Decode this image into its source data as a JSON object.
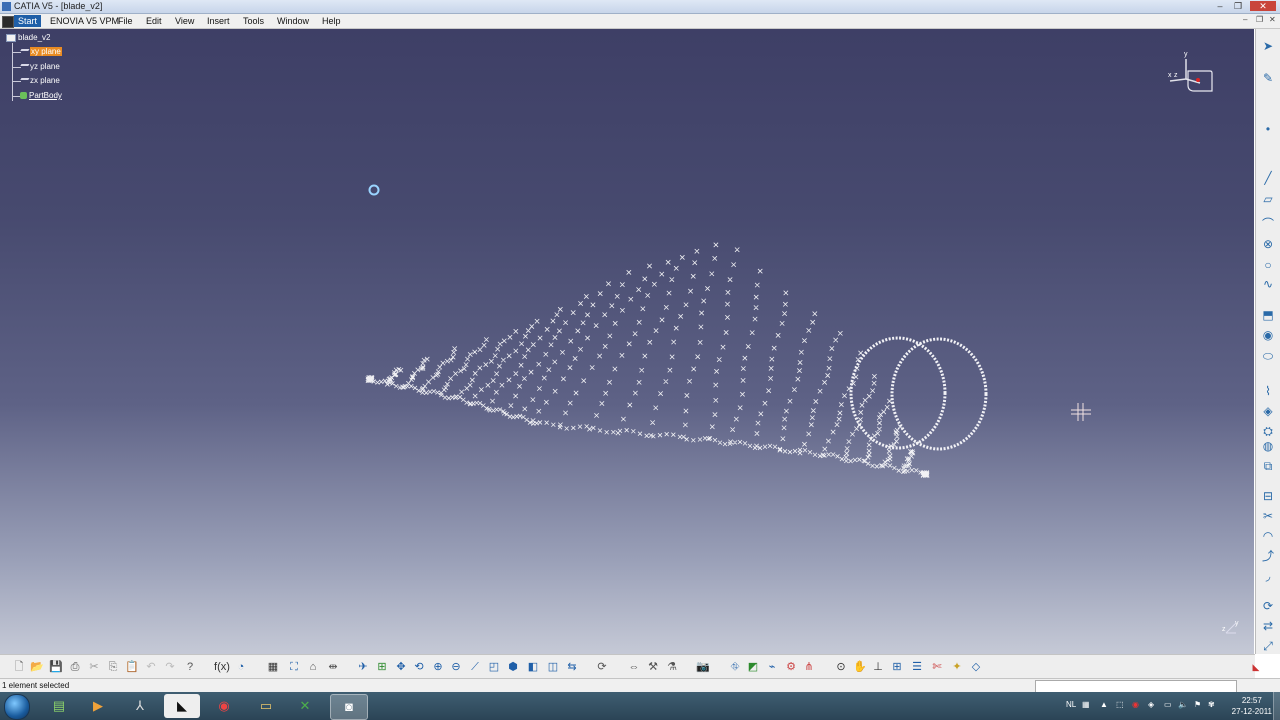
{
  "window": {
    "title": "CATIA V5 - [blade_v2]",
    "controls": [
      "–",
      "❐",
      "✕"
    ],
    "inner_controls": [
      "–",
      "❐",
      "✕"
    ]
  },
  "menu": {
    "items": [
      "Start",
      "ENOVIA V5 VPM",
      "File",
      "Edit",
      "View",
      "Insert",
      "Tools",
      "Window",
      "Help"
    ]
  },
  "tree": {
    "root": "blade_v2",
    "children": [
      "xy plane",
      "yz plane",
      "zx plane",
      "PartBody"
    ],
    "selected": "xy plane"
  },
  "compass": {
    "y_label": "y",
    "x_label": "x",
    "z_label": "z"
  },
  "axis_corner": {
    "y_label": "y",
    "z_label": "z"
  },
  "status": {
    "text": "1 element selected"
  },
  "taskbar": {
    "apps": [
      "Windows Explorer",
      "Excel",
      "Media Player",
      "Adobe",
      "App",
      "Chrome",
      "Folder",
      "Excel Doc",
      "CATIA"
    ],
    "clock_time": "22:57",
    "clock_date": "27-12-2011",
    "lang": "NL"
  },
  "colors": {
    "viewport_top": "#3e3f66",
    "viewport_bottom": "#c5c9d6",
    "selection": "#e98b22",
    "geometry": "#ffffff"
  }
}
